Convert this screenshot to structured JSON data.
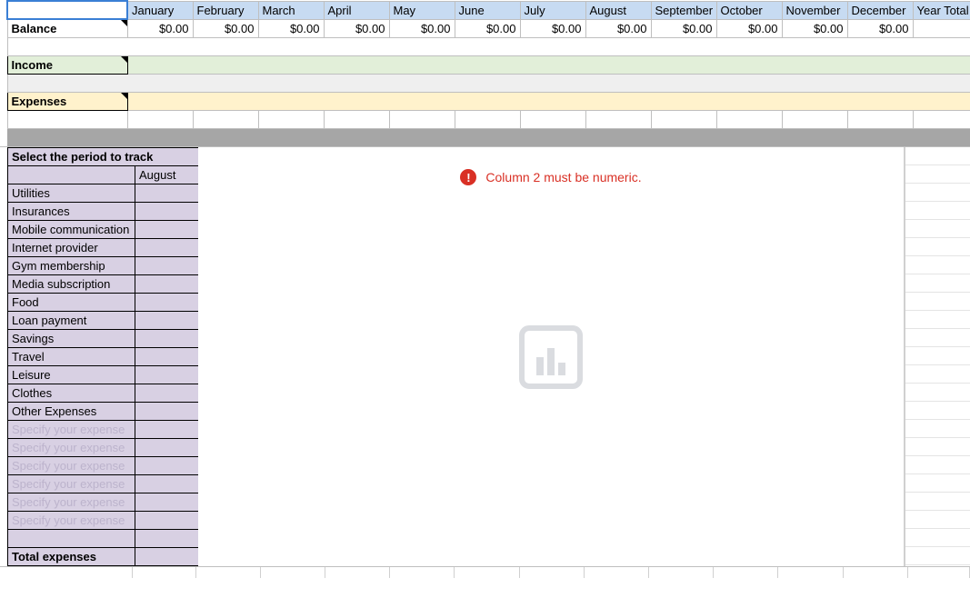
{
  "months": [
    "January",
    "February",
    "March",
    "April",
    "May",
    "June",
    "July",
    "August",
    "September",
    "October",
    "November",
    "December"
  ],
  "year_total_label": "Year Total",
  "balance": {
    "label": "Balance",
    "values": [
      "$0.00",
      "$0.00",
      "$0.00",
      "$0.00",
      "$0.00",
      "$0.00",
      "$0.00",
      "$0.00",
      "$0.00",
      "$0.00",
      "$0.00",
      "$0.00"
    ],
    "year_total": ""
  },
  "income_label": "Income",
  "expenses_label": "Expenses",
  "period_tracker": {
    "title": "Select the period to track",
    "selected_month": "August",
    "categories": [
      "Utilities",
      "Insurances",
      "Mobile communication",
      "Internet provider",
      "Gym membership",
      "Media subscription",
      "Food",
      "Loan payment",
      "Savings",
      "Travel",
      "Leisure",
      "Clothes",
      "Other Expenses"
    ],
    "placeholder_rows": [
      "Specify your expense",
      "Specify your expense",
      "Specify your expense",
      "Specify your expense",
      "Specify your expense",
      "Specify your expense"
    ],
    "total_label": "Total expenses"
  },
  "chart": {
    "error_text": "Column 2 must be numeric."
  },
  "chart_data": {
    "type": "bar",
    "categories": [
      "Utilities",
      "Insurances",
      "Mobile communication",
      "Internet provider",
      "Gym membership",
      "Media subscription",
      "Food",
      "Loan payment",
      "Savings",
      "Travel",
      "Leisure",
      "Clothes",
      "Other Expenses"
    ],
    "values": [
      null,
      null,
      null,
      null,
      null,
      null,
      null,
      null,
      null,
      null,
      null,
      null,
      null
    ],
    "title": "",
    "xlabel": "",
    "ylabel": "",
    "note": "Chart fails to render: numeric column empty"
  }
}
